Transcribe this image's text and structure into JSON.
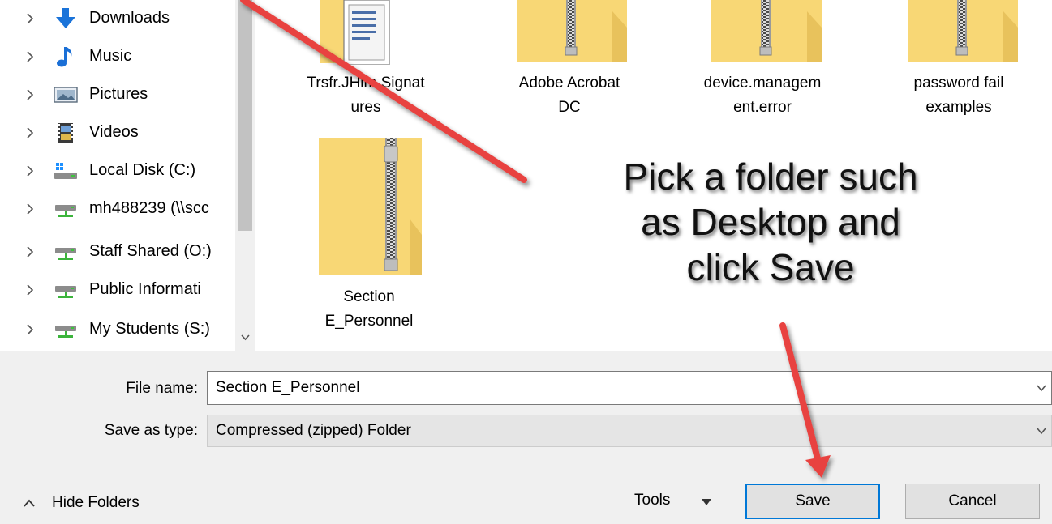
{
  "navigation": {
    "items": [
      {
        "label": "Downloads",
        "icon": "downloads-icon"
      },
      {
        "label": "Music",
        "icon": "music-icon"
      },
      {
        "label": "Pictures",
        "icon": "pictures-icon"
      },
      {
        "label": "Videos",
        "icon": "videos-icon"
      },
      {
        "label": "Local Disk (C:)",
        "icon": "local-disk-icon"
      },
      {
        "label": "mh488239 (\\\\scc",
        "icon": "network-drive-icon"
      },
      {
        "label": "Staff Shared (O:)",
        "icon": "network-drive-icon"
      },
      {
        "label": "Public Informati",
        "icon": "network-drive-icon"
      },
      {
        "label": "My Students (S:)",
        "icon": "network-drive-icon"
      }
    ]
  },
  "files": [
    {
      "name_line1": "Trsfr.JHim.Signat",
      "name_line2": "ures",
      "icon": "document-folder-icon"
    },
    {
      "name_line1": "Adobe Acrobat",
      "name_line2": "DC",
      "icon": "zip-folder-icon"
    },
    {
      "name_line1": "device.managem",
      "name_line2": "ent.error",
      "icon": "zip-folder-icon"
    },
    {
      "name_line1": "password fail",
      "name_line2": "examples",
      "icon": "zip-folder-icon"
    },
    {
      "name_line1": "Section",
      "name_line2": "E_Personnel",
      "icon": "zip-folder-icon"
    }
  ],
  "annotation": {
    "line1": "Pick a folder such",
    "line2": "as Desktop and",
    "line3": "click Save",
    "arrow_color": "#e8433f"
  },
  "form": {
    "filename_label": "File name:",
    "filename_value": "Section E_Personnel",
    "type_label": "Save as type:",
    "type_value": "Compressed (zipped) Folder"
  },
  "footer": {
    "hide_folders_label": "Hide Folders",
    "tools_label": "Tools",
    "save_label": "Save",
    "cancel_label": "Cancel"
  },
  "colors": {
    "folder": "#f8d775",
    "accent": "#0078d7"
  }
}
